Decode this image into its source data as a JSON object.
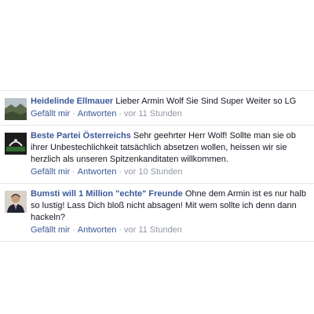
{
  "comments": [
    {
      "author": "Heidelinde Ellmauer",
      "text": "Lieber Armin Wolf Sie Sind Super Weiter so LG",
      "like_label": "Gefällt mir",
      "separator": "·",
      "reply_label": "Antworten",
      "time": "vor 11 Stunden",
      "avatar_icon": "landscape-photo-avatar"
    },
    {
      "author": "Beste Partei Österreichs",
      "text": "Sehr geehrter Herr Wolf! Sollte man sie ob ihrer Unbestechlichkeit tatsächlich absetzen wollen, heissen wir sie herzlich als unseren Spitzenkanditaten willkommen.",
      "like_label": "Gefällt mir",
      "separator": "·",
      "reply_label": "Antworten",
      "time": "vor 10 Stunden",
      "avatar_icon": "party-logo-avatar"
    },
    {
      "author": "Bumsti will 1 Million \"echte\" Freunde",
      "text": "Ohne dem Armin ist es nur halb so lustig! Lass Dich bloß nicht absagen! Mit wem sollte ich denn dann hackeln?",
      "like_label": "Gefällt mir",
      "separator": "·",
      "reply_label": "Antworten",
      "time": "vor 11 Stunden",
      "avatar_icon": "person-photo-avatar"
    }
  ],
  "colors": {
    "link": "#3b5998",
    "meta": "#9197a3",
    "text": "#141823",
    "divider": "#e5e6e9"
  }
}
